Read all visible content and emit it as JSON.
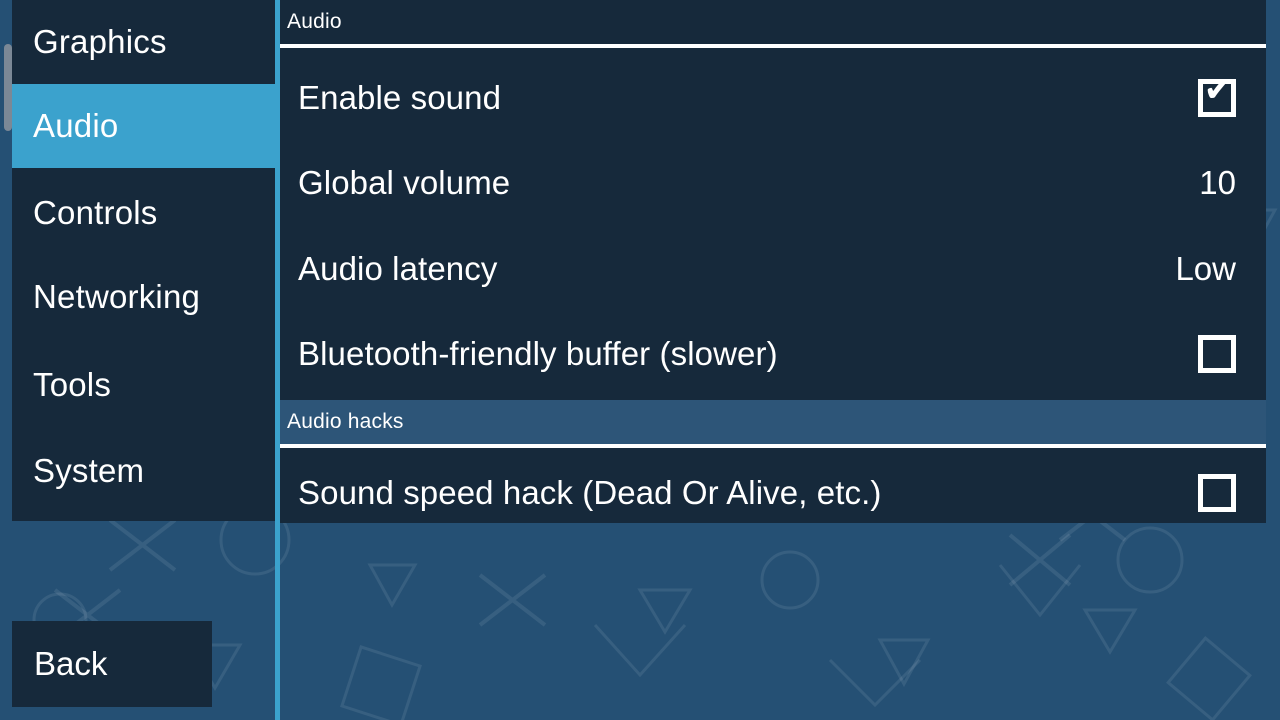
{
  "app": {
    "accent_color": "#3ba2cd",
    "panel_color": "#16293b",
    "page_background_color": "#255074",
    "section_band_color": "#2d5578",
    "text_color": "#ffffff"
  },
  "sidebar": {
    "items": [
      {
        "label": "Graphics",
        "selected": false
      },
      {
        "label": "Audio",
        "selected": true
      },
      {
        "label": "Controls",
        "selected": false
      },
      {
        "label": "Networking",
        "selected": false
      },
      {
        "label": "Tools",
        "selected": false
      },
      {
        "label": "System",
        "selected": false
      }
    ],
    "back_label": "Back"
  },
  "content": {
    "sections": [
      {
        "title": "Audio",
        "style": "dark",
        "rows": [
          {
            "label": "Enable sound",
            "control": "checkbox",
            "checked": true,
            "check_glyph": "✔"
          },
          {
            "label": "Global volume",
            "control": "value",
            "value": "10"
          },
          {
            "label": "Audio latency",
            "control": "value",
            "value": "Low"
          },
          {
            "label": "Bluetooth-friendly buffer (slower)",
            "control": "checkbox",
            "checked": false,
            "check_glyph": ""
          }
        ]
      },
      {
        "title": "Audio hacks",
        "style": "light",
        "rows": [
          {
            "label": "Sound speed hack (Dead Or Alive, etc.)",
            "control": "checkbox",
            "checked": false,
            "check_glyph": ""
          }
        ]
      }
    ]
  }
}
